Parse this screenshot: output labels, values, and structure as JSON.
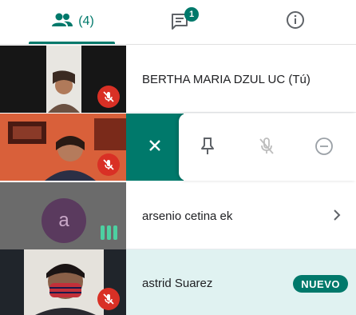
{
  "tabs": {
    "people_count": "(4)",
    "chat_badge": "1"
  },
  "participants": [
    {
      "name": "BERTHA MARIA DZUL UC (Tú)",
      "muted": true
    },
    {
      "name": "",
      "muted": true,
      "actions": [
        "close",
        "pin",
        "mute",
        "remove"
      ]
    },
    {
      "name": "arsenio cetina ek",
      "avatar_letter": "a",
      "speaking": true
    },
    {
      "name": "astrid Suarez",
      "badge": "NUEVO",
      "muted": true
    }
  ],
  "colors": {
    "accent": "#00796b",
    "mic_off": "#d93025",
    "new_row_bg": "#e0f2f1"
  },
  "icons": [
    "people-icon",
    "chat-icon",
    "info-icon",
    "mic-off-icon",
    "close-icon",
    "pin-icon",
    "remove-icon",
    "chevron-right-icon"
  ]
}
